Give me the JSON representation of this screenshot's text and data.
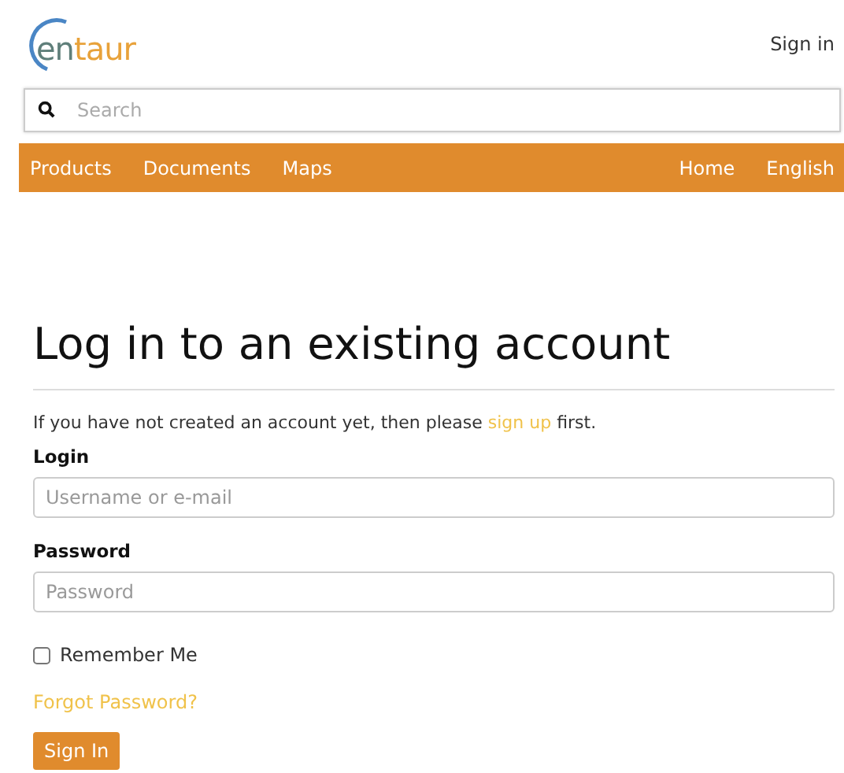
{
  "header": {
    "logo": [
      "en",
      "taur"
    ],
    "sign_in": "Sign in"
  },
  "search": {
    "placeholder": "Search"
  },
  "nav": {
    "left": [
      "Products",
      "Documents",
      "Maps"
    ],
    "right": [
      "Home",
      "English"
    ]
  },
  "form": {
    "title": "Log in to an existing account",
    "intro": {
      "before": "If you have not created an account yet, then please ",
      "link": "sign up",
      "after": " first."
    },
    "login_label": "Login",
    "login_placeholder": "Username or e-mail",
    "password_label": "Password",
    "password_placeholder": "Password",
    "remember": {
      "label": "Remember Me",
      "checked": false
    },
    "forgot": "Forgot Password?",
    "submit": "Sign In"
  }
}
